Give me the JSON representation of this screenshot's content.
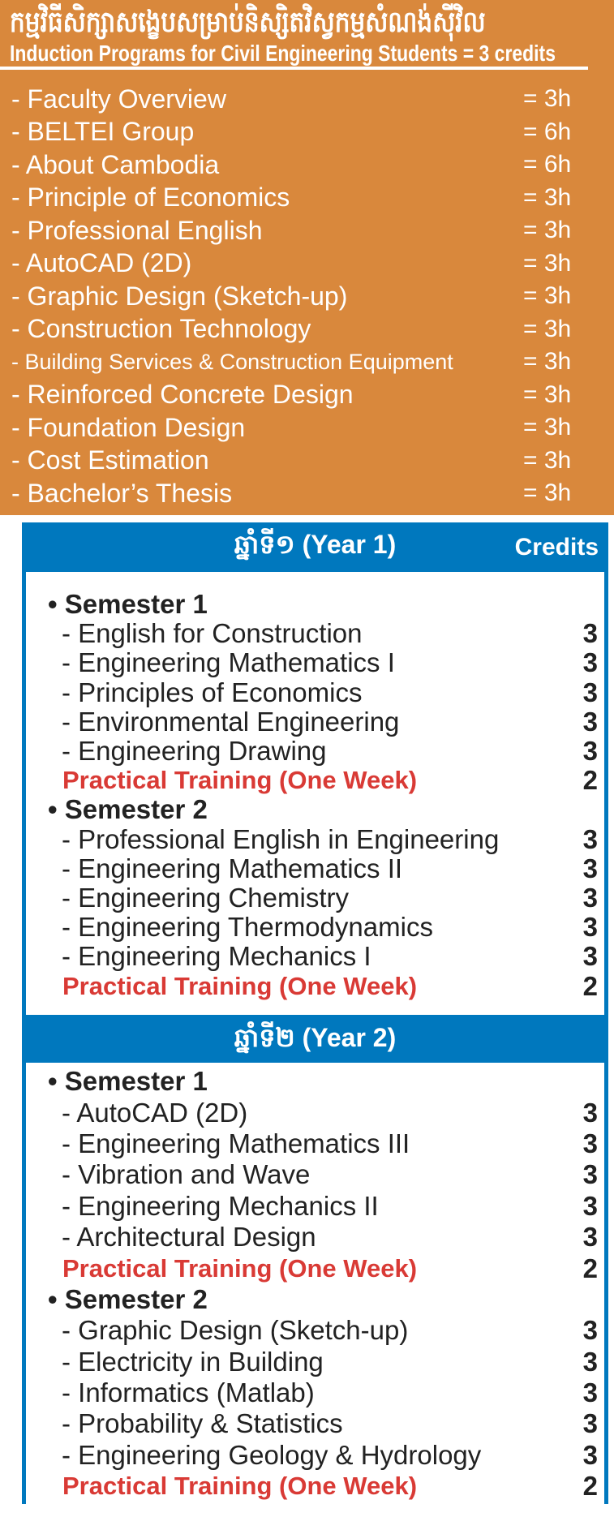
{
  "header": {
    "title_kh": "កម្មវិធីសិក្សាសង្ខេបសម្រាប់និស្សិតវិស្វកម្មសំណង់ស៊ីវិល",
    "title_en": "Induction Programs for Civil Engineering Students = 3 credits"
  },
  "induction": [
    {
      "label": "- Faculty Overview",
      "value": "= 3h"
    },
    {
      "label": "- BELTEI Group",
      "value": "= 6h"
    },
    {
      "label": "- About Cambodia",
      "value": "= 6h"
    },
    {
      "label": "- Principle of Economics",
      "value": "= 3h"
    },
    {
      "label": "- Professional English",
      "value": "= 3h"
    },
    {
      "label": "- AutoCAD (2D)",
      "value": "= 3h"
    },
    {
      "label": "- Graphic Design (Sketch-up)",
      "value": "= 3h"
    },
    {
      "label": "- Construction Technology",
      "value": "= 3h"
    },
    {
      "label": "- Building Services & Construction Equipment",
      "value": "= 3h"
    },
    {
      "label": "- Reinforced Concrete Design",
      "value": "= 3h"
    },
    {
      "label": "- Foundation Design",
      "value": "= 3h"
    },
    {
      "label": "- Cost Estimation",
      "value": "= 3h"
    },
    {
      "label": "- Bachelor’s Thesis",
      "value": "= 3h"
    }
  ],
  "credits_label": "Credits",
  "years": [
    {
      "title": "ឆ្នាំទី១ (Year 1)",
      "rows": [
        {
          "type": "sem",
          "label": "Semester 1",
          "credits": ""
        },
        {
          "type": "item",
          "label": "- English for Construction",
          "credits": "3"
        },
        {
          "type": "item",
          "label": "- Engineering Mathematics I",
          "credits": "3"
        },
        {
          "type": "item",
          "label": "- Principles of Economics",
          "credits": "3"
        },
        {
          "type": "item",
          "label": "- Environmental Engineering",
          "credits": "3"
        },
        {
          "type": "item",
          "label": "- Engineering Drawing",
          "credits": "3"
        },
        {
          "type": "prac",
          "label": "Practical Training (One Week)",
          "credits": "2"
        },
        {
          "type": "sem",
          "label": "Semester 2",
          "credits": ""
        },
        {
          "type": "item",
          "label": "- Professional English in Engineering",
          "credits": "3"
        },
        {
          "type": "item",
          "label": "- Engineering Mathematics II",
          "credits": "3"
        },
        {
          "type": "item",
          "label": "- Engineering Chemistry",
          "credits": "3"
        },
        {
          "type": "item",
          "label": "- Engineering Thermodynamics",
          "credits": "3"
        },
        {
          "type": "item",
          "label": "- Engineering Mechanics I",
          "credits": "3"
        },
        {
          "type": "prac",
          "label": "Practical Training (One Week)",
          "credits": "2"
        }
      ]
    },
    {
      "title": "ឆ្នាំទី២ (Year 2)",
      "rows": [
        {
          "type": "sem",
          "label": "Semester 1",
          "credits": ""
        },
        {
          "type": "item",
          "label": "- AutoCAD (2D)",
          "credits": "3"
        },
        {
          "type": "item",
          "label": "- Engineering Mathematics III",
          "credits": "3"
        },
        {
          "type": "item",
          "label": "- Vibration and Wave",
          "credits": "3"
        },
        {
          "type": "item",
          "label": "- Engineering Mechanics II",
          "credits": "3"
        },
        {
          "type": "item",
          "label": "- Architectural Design",
          "credits": "3"
        },
        {
          "type": "prac",
          "label": "Practical Training (One Week)",
          "credits": "2"
        },
        {
          "type": "sem",
          "label": "Semester 2",
          "credits": ""
        },
        {
          "type": "item",
          "label": "- Graphic Design (Sketch-up)",
          "credits": "3"
        },
        {
          "type": "item",
          "label": "- Electricity in Building",
          "credits": "3"
        },
        {
          "type": "item",
          "label": "- Informatics (Matlab)",
          "credits": "3"
        },
        {
          "type": "item",
          "label": "- Probability & Statistics",
          "credits": "3"
        },
        {
          "type": "item",
          "label": "- Engineering Geology & Hydrology",
          "credits": "3"
        },
        {
          "type": "prac",
          "label": "Practical Training (One Week)",
          "credits": "2"
        }
      ]
    }
  ],
  "colors": {
    "orange": "#d9883c",
    "blue": "#0078be",
    "red": "#d93a35"
  }
}
